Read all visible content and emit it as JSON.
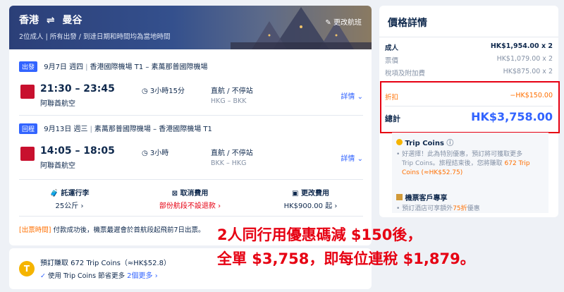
{
  "header": {
    "from": "香港",
    "swap": "⇌",
    "to": "曼谷",
    "subtitle": "2位成人  |  所有出發 / 到達日期和時間均為當地時間",
    "change_label": "更改航班"
  },
  "outbound": {
    "badge": "出發",
    "date": "9月7日 週四",
    "route": "香港國際機場 T1 – 素萬那普國際機場",
    "time": "21:30 – 23:45",
    "duration": "3小時15分",
    "stop": "直航 / 不停站",
    "codes": "HKG – BKK",
    "airline": "阿聯酋航空",
    "details": "詳情"
  },
  "inbound": {
    "badge": "回程",
    "date": "9月13日 週三",
    "route": "素萬那普國際機場 – 香港國際機場 T1",
    "time": "14:05 – 18:05",
    "duration": "3小時",
    "stop": "直航 / 不停站",
    "codes": "BKK – HKG",
    "airline": "阿聯酋航空",
    "details": "詳情"
  },
  "info_bar": {
    "baggage_title": "託運行李",
    "baggage_value": "25公斤",
    "cancel_title": "取消費用",
    "cancel_value": "部份航段不設退款",
    "change_title": "更改費用",
    "change_value": "HK$900.00 起"
  },
  "notice": {
    "tag": "[出票時間]",
    "text": "付款成功後，機票最遲會於首航段起飛前7日出票。"
  },
  "coins": {
    "title": "預訂賺取 672 Trip Coins（≈HK$52.8）",
    "use": "使用 Trip Coins 節省更多",
    "more": "2個更多"
  },
  "price": {
    "title": "價格詳情",
    "adult_label": "成人",
    "adult_value": "HK$1,954.00 x 2",
    "fare_label": "票價",
    "fare_value": "HK$1,079.00 x 2",
    "tax_label": "稅項及附加費",
    "tax_value": "HK$875.00 x 2",
    "discount_label": "折扣",
    "discount_value": "−HK$150.00",
    "total_label": "總計",
    "total_value": "HK$3,758.00"
  },
  "perks": {
    "coins_title": "Trip Coins",
    "coins_text_1": "好選擇！此為特別優惠，預訂將可獲取更多",
    "coins_text_2a": "Trip Coins。旅程結束後，您將賺取",
    "coins_text_2b": "672 Trip",
    "coins_text_3": "Coins (≈HK$52.75)",
    "member_title": "機票客戶專享",
    "member_text_a": "預訂酒店可享額外",
    "member_text_b": "75折",
    "member_text_c": "優惠"
  },
  "overlay": {
    "line1": "2人同行用優惠碼減 $150後，",
    "line2": "全單 $3,758，即每位連稅 $1,879。"
  },
  "colors": {
    "accent": "#3264ff",
    "red": "#e60012",
    "orange": "#ff6f00",
    "navy": "#0f294d"
  }
}
